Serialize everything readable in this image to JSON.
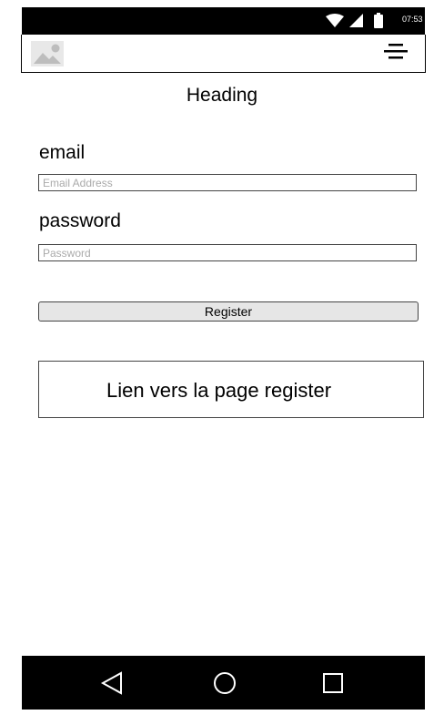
{
  "status_bar": {
    "time": "07:53",
    "icons": [
      "wifi-icon",
      "signal-icon",
      "battery-icon"
    ]
  },
  "app_bar": {
    "icons": [
      "image-placeholder-icon",
      "hamburger-menu-icon"
    ]
  },
  "heading": "Heading",
  "form": {
    "email_label": "email",
    "email_placeholder": "Email Address",
    "password_label": "password",
    "password_placeholder": "Password",
    "register_button": "Register"
  },
  "register_link": "Lien vers la page register",
  "nav_bar": {
    "icons": [
      "back-icon",
      "home-icon",
      "recent-apps-icon"
    ]
  },
  "colors": {
    "status_bar": "#000000",
    "nav_bar": "#000000",
    "button_bg": "#e6e6e6",
    "placeholder": "#aaaaaa",
    "image_icon": "#cccccc"
  }
}
